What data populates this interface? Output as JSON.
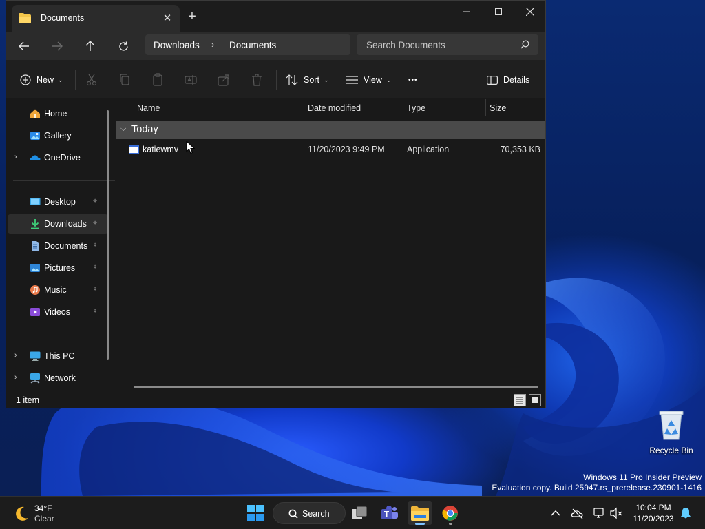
{
  "window": {
    "tab_title": "Documents",
    "tab_close": "✕",
    "new_tab": "+"
  },
  "address": {
    "crumbs": [
      "Downloads",
      "Documents"
    ],
    "separator": "›",
    "search_placeholder": "Search Documents"
  },
  "toolbar": {
    "new_label": "New",
    "sort_label": "Sort",
    "view_label": "View",
    "more_label": "•••",
    "details_label": "Details",
    "chevron": "⌄"
  },
  "sidebar": {
    "items": [
      {
        "label": "Home",
        "icon": "home-icon"
      },
      {
        "label": "Gallery",
        "icon": "gallery-icon"
      },
      {
        "label": "OneDrive",
        "icon": "onedrive-icon"
      },
      {
        "label": "Desktop",
        "icon": "desktop-icon"
      },
      {
        "label": "Downloads",
        "icon": "download-icon"
      },
      {
        "label": "Documents",
        "icon": "documents-icon"
      },
      {
        "label": "Pictures",
        "icon": "pictures-icon"
      },
      {
        "label": "Music",
        "icon": "music-icon"
      },
      {
        "label": "Videos",
        "icon": "videos-icon"
      },
      {
        "label": "This PC",
        "icon": "pc-icon"
      },
      {
        "label": "Network",
        "icon": "network-icon"
      }
    ],
    "selected": "Downloads",
    "pin_glyph": "📌",
    "expand_glyph": "›"
  },
  "list": {
    "columns": [
      "Name",
      "Date modified",
      "Type",
      "Size"
    ],
    "group_label": "Today",
    "group_chevron": "⌵",
    "files": [
      {
        "name": "katiewmv",
        "date": "11/20/2023 9:49 PM",
        "type": "Application",
        "size": "70,353 KB"
      }
    ]
  },
  "status": {
    "count": "1 item"
  },
  "desktop": {
    "recycle_bin": "Recycle Bin",
    "watermark_line1": "Windows 11 Pro Insider Preview",
    "watermark_line2": "Evaluation copy. Build 25947.rs_prerelease.230901-1416"
  },
  "taskbar": {
    "temperature": "34°F",
    "condition": "Clear",
    "search_label": "Search",
    "time": "10:04 PM",
    "date": "11/20/2023"
  },
  "colors": {
    "accent": "#60cdff",
    "window_bg": "#191919",
    "selected_row": "#2d2d2d",
    "group_header": "#4a4a4a"
  }
}
